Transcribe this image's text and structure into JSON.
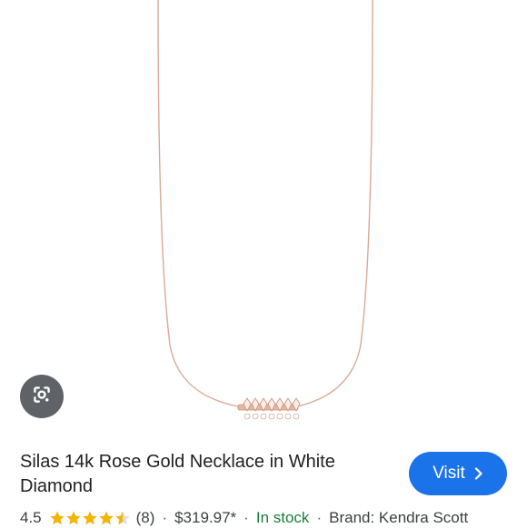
{
  "product": {
    "title": "Silas 14k Rose Gold Necklace in White Diamond",
    "rating": "4.5",
    "rating_value": 4.5,
    "rating_max": 5,
    "review_count": "(8)",
    "price": "$319.97*",
    "stock": "In stock",
    "brand": "Brand: Kendra Scott"
  },
  "actions": {
    "visit_label": "Visit",
    "lens_icon": "google-lens-icon",
    "visit_icon": "chevron-right-icon"
  },
  "colors": {
    "visit_button": "#1a73e8",
    "star": "#f4b400",
    "in_stock": "#188038",
    "chain": "#d9a58e",
    "lens_button": "#5f6368"
  }
}
